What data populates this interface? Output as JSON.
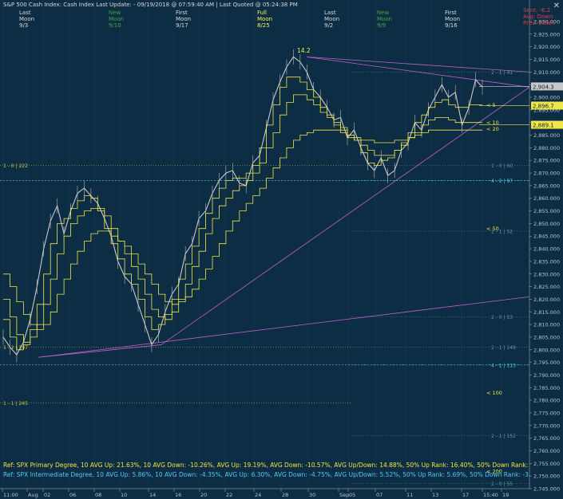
{
  "title": "S&P 500 Cash Index:  Cash Index  Last Update: - 09/19/2018 @ 07:59:40 AM | Last Quoted @ 05:24:38 PM",
  "close_icon": "close-icon",
  "moon_table": {
    "col1": {
      "row1": "Last",
      "row2": "Moon",
      "row3": "9/3"
    },
    "col2": {
      "row1": "New",
      "row2": "Moon",
      "row3": "9/10"
    },
    "col3": {
      "row1": "First",
      "row2": "Moon",
      "row3": "9/17"
    },
    "col4": {
      "row1": "Full",
      "row2": "Moon",
      "row3": "8/25"
    },
    "col5": {
      "row1": "Last",
      "row2": "Moon",
      "row3": "9/2"
    },
    "col6": {
      "row1": "New",
      "row2": "Moon",
      "row3": "9/9"
    },
    "col7": {
      "row1": "First",
      "row2": "Moon",
      "row3": "9/16"
    }
  },
  "top_right": {
    "line1": "Sent: -6.2",
    "line2": "Avg: Down",
    "line3": "Prev: Down"
  },
  "peak_label": "14.2",
  "y_axis": {
    "min": 2745,
    "max": 2930,
    "step": 5
  },
  "x_axis_labels": [
    "11:00",
    "Aug",
    "02",
    "06",
    "08",
    "10",
    "14",
    "16",
    "20",
    "22",
    "24",
    "28",
    "30",
    "Sep",
    "05",
    "07",
    "11",
    "13",
    "17",
    "15:40",
    "19"
  ],
  "price_boxes": [
    {
      "value": "2,904.3",
      "price": 2904.3,
      "color": "#c8c8c8"
    },
    {
      "value": "2,896.7",
      "price": 2896.7,
      "color": "#f0e64a"
    },
    {
      "value": "2,889.1",
      "price": 2889.1,
      "color": "#f0e64a"
    }
  ],
  "ma_labels": [
    {
      "text": "< 5",
      "price": 2897
    },
    {
      "text": "< 10",
      "price": 2890
    },
    {
      "text": "< 20",
      "price": 2887.5
    },
    {
      "text": "< 50",
      "price": 2848
    },
    {
      "text": "< 100",
      "price": 2783
    },
    {
      "text": "< 200",
      "price": 2752
    }
  ],
  "level_labels": [
    {
      "text": "2 - 1 | 41",
      "price": 2910,
      "side": "right",
      "color": "#5a9aa8"
    },
    {
      "text": "1 - 0 | 60",
      "price": 2873,
      "side": "right",
      "color": "#5a9aa8"
    },
    {
      "text": "4 - 2 | 97",
      "price": 2867,
      "side": "right",
      "color": "#4fd2e8"
    },
    {
      "text": "2 - 1 | 52",
      "price": 2847,
      "side": "right",
      "color": "#5a9aa8"
    },
    {
      "text": "2 - 0 | 53",
      "price": 2813,
      "side": "right",
      "color": "#5a9aa8"
    },
    {
      "text": "2 - 1 | 149",
      "price": 2801,
      "side": "right",
      "color": "#5a9aa8"
    },
    {
      "text": "4 - 1 | 115",
      "price": 2794,
      "side": "right",
      "color": "#4fd2e8"
    },
    {
      "text": "2 - 1 | 152",
      "price": 2766,
      "side": "right",
      "color": "#5a9aa8"
    },
    {
      "text": "2 - 0 | 55",
      "price": 2747,
      "side": "right",
      "color": "#5a9aa8"
    },
    {
      "text": "1 - 0 | 222",
      "price": 2873,
      "side": "left",
      "color": "#c8c840"
    },
    {
      "text": "1 - 2 | 197",
      "price": 2801,
      "side": "left",
      "color": "#c8c840"
    },
    {
      "text": "1 - 1 | 245",
      "price": 2779,
      "side": "left",
      "color": "#c8c840"
    }
  ],
  "footer": {
    "line1": "Ref: SPX Primary Degree, 10 AVG Up: 21.63%, 10 AVG Down: -10.26%, AVG Up: 19.19%, AVG Down: -10.57%, AVG Up/Down: 14.88%, 50%  Up Rank: 16.40%, 50% Down Rank: -9.84%, Maximum Up: 58.71%, Maximum",
    "line2": "Ref: SPX Intermediate Degree, 10 AVG Up: 5.86%, 10 AVG Down: -4.35%, AVG Up: 6.30%, AVG Down: -4.75%, AVG Up/Down: 5.52%, 50%  Up Rank: 5.69%, 50% Down Rank: -3.87%, Maximum Up: 20.27%, Maximum Dc"
  },
  "chart_data": {
    "type": "line",
    "title": "S&P 500 Cash Index",
    "ylim": [
      2745,
      2930
    ],
    "series": [
      {
        "name": "SPX",
        "color": "#c8c8c8",
        "y": [
          2805,
          2801,
          2798,
          2803,
          2812,
          2825,
          2840,
          2851,
          2857,
          2846,
          2855,
          2862,
          2864,
          2861,
          2858,
          2852,
          2845,
          2835,
          2829,
          2826,
          2818,
          2810,
          2802,
          2806,
          2815,
          2822,
          2826,
          2838,
          2842,
          2852,
          2855,
          2862,
          2867,
          2870,
          2871,
          2866,
          2865,
          2874,
          2877,
          2888,
          2899,
          2906,
          2912,
          2916,
          2914,
          2910,
          2903,
          2900,
          2896,
          2891,
          2892,
          2884,
          2887,
          2880,
          2874,
          2871,
          2876,
          2869,
          2871,
          2879,
          2882,
          2890,
          2887,
          2895,
          2900,
          2905,
          2900,
          2902,
          2889,
          2896,
          2907,
          2904
        ]
      },
      {
        "name": "< 5",
        "color": "#f0e64a",
        "y": [
          2812,
          2805,
          2800,
          2802,
          2808,
          2818,
          2830,
          2842,
          2850,
          2852,
          2856,
          2859,
          2861,
          2860,
          2855,
          2848,
          2842,
          2836,
          2830,
          2826,
          2820,
          2813,
          2808,
          2810,
          2814,
          2820,
          2828,
          2834,
          2841,
          2848,
          2854,
          2860,
          2864,
          2867,
          2868,
          2868,
          2870,
          2873,
          2880,
          2889,
          2897,
          2904,
          2908,
          2908,
          2906,
          2903,
          2900,
          2896,
          2893,
          2890,
          2888,
          2885,
          2883,
          2878,
          2874,
          2873,
          2875,
          2876,
          2879,
          2882,
          2886,
          2890,
          2893,
          2896,
          2898,
          2899,
          2897,
          2896,
          2896,
          2897,
          2897,
          2897
        ]
      },
      {
        "name": "< 10",
        "color": "#f0e64a",
        "y": [
          2820,
          2813,
          2806,
          2803,
          2805,
          2810,
          2818,
          2828,
          2838,
          2845,
          2850,
          2853,
          2855,
          2856,
          2856,
          2853,
          2848,
          2843,
          2838,
          2833,
          2828,
          2822,
          2816,
          2813,
          2812,
          2815,
          2820,
          2826,
          2833,
          2839,
          2846,
          2852,
          2857,
          2860,
          2863,
          2865,
          2867,
          2870,
          2874,
          2880,
          2886,
          2893,
          2898,
          2901,
          2901,
          2899,
          2897,
          2894,
          2892,
          2889,
          2887,
          2884,
          2883,
          2881,
          2879,
          2877,
          2877,
          2877,
          2879,
          2881,
          2884,
          2886,
          2889,
          2891,
          2892,
          2892,
          2891,
          2890,
          2890,
          2890,
          2890,
          2890
        ]
      },
      {
        "name": "< 20",
        "color": "#f0e64a",
        "y": [
          2830,
          2825,
          2819,
          2814,
          2810,
          2808,
          2810,
          2815,
          2822,
          2828,
          2834,
          2839,
          2843,
          2846,
          2847,
          2847,
          2845,
          2843,
          2841,
          2838,
          2834,
          2830,
          2826,
          2822,
          2819,
          2818,
          2819,
          2821,
          2824,
          2828,
          2832,
          2837,
          2842,
          2847,
          2851,
          2855,
          2858,
          2861,
          2864,
          2868,
          2872,
          2876,
          2880,
          2883,
          2885,
          2886,
          2887,
          2887,
          2887,
          2887,
          2886,
          2885,
          2884,
          2883,
          2883,
          2882,
          2882,
          2882,
          2883,
          2883,
          2884,
          2885,
          2886,
          2887,
          2887,
          2887,
          2887,
          2887,
          2887,
          2887,
          2887,
          2887
        ]
      }
    ]
  }
}
